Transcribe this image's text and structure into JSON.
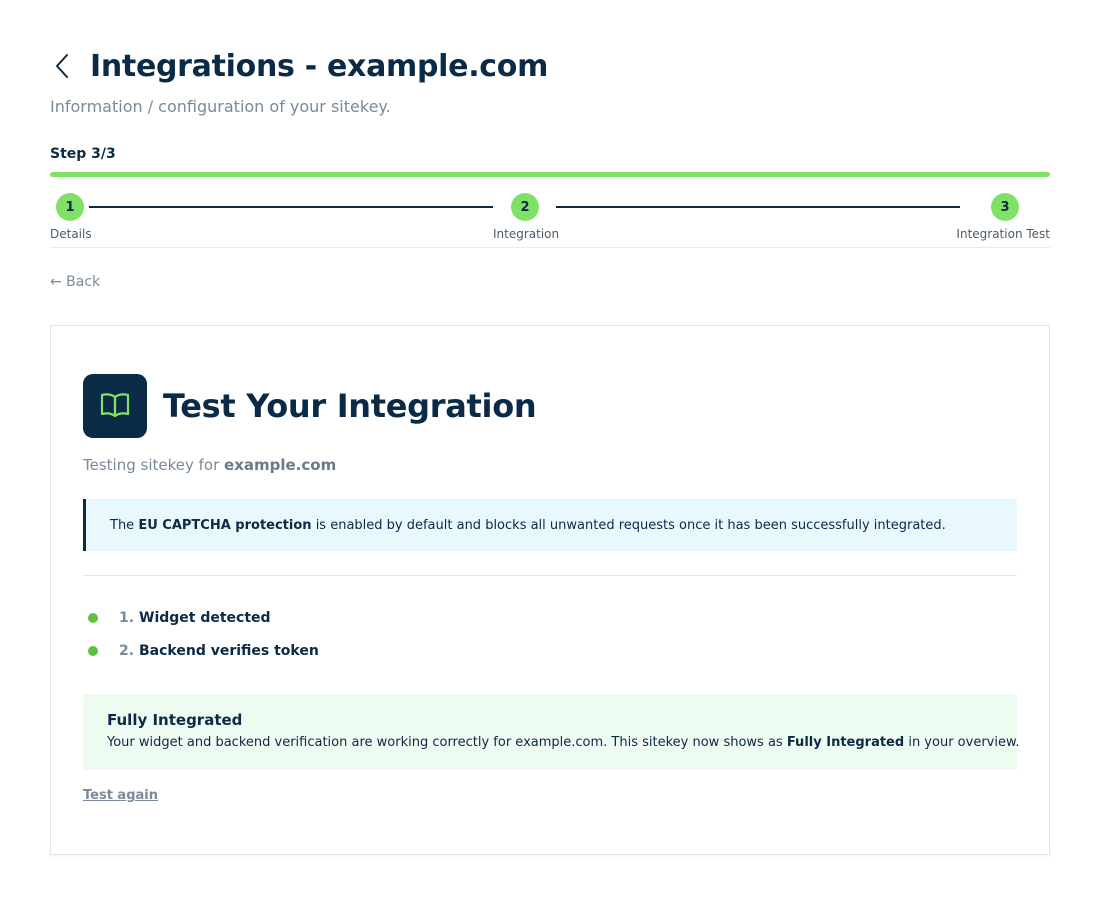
{
  "header": {
    "title": "Integrations - example.com",
    "subtitle": "Information / configuration of your sitekey."
  },
  "progress": {
    "label": "Step 3/3",
    "percent": 100
  },
  "steps": [
    {
      "number": "1",
      "label": "Details"
    },
    {
      "number": "2",
      "label": "Integration"
    },
    {
      "number": "3",
      "label": "Integration Test"
    }
  ],
  "nav": {
    "back_label": "← Back"
  },
  "card": {
    "title": "Test Your Integration",
    "icon": "book-open-icon",
    "testing_prefix": "Testing sitekey for",
    "domain": "example.com",
    "info": {
      "prefix": "The",
      "highlight": "EU CAPTCHA protection",
      "suffix": "is enabled by default and blocks all unwanted requests once it has been successfully integrated."
    },
    "checks": [
      {
        "number": "1.",
        "label": "Widget detected",
        "status": "success"
      },
      {
        "number": "2.",
        "label": "Backend verifies token",
        "status": "success"
      }
    ],
    "result": {
      "title": "Fully Integrated",
      "message_prefix": "Your widget and backend verification are working correctly for example.com. This sitekey now shows as",
      "message_highlight": "Fully Integrated",
      "message_suffix": "in your overview."
    },
    "test_again_label": "Test again"
  },
  "colors": {
    "primary": "#0b2a45",
    "accent_green": "#7fe266",
    "status_green": "#5cc140",
    "info_bg": "#e9f8fc",
    "success_bg": "#eefbf1"
  }
}
